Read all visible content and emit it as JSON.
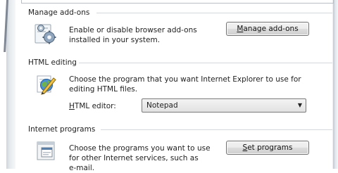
{
  "manage_addons": {
    "group_title": "Manage add-ons",
    "description_line1": "Enable or disable browser add-ons",
    "description_line2": "installed in your system.",
    "button_label_rest": "anage add-ons",
    "button_mnemonic": "M",
    "icon": "gears-icon"
  },
  "html_editing": {
    "group_title": "HTML editing",
    "description_line1": "Choose the program that you want Internet Explorer to use for",
    "description_line2": "editing HTML files.",
    "editor_label_mnemonic": "H",
    "editor_label_rest": "TML editor:",
    "editor_value": "Notepad",
    "icon": "pencil-page-icon"
  },
  "internet_programs": {
    "group_title": "Internet programs",
    "description_line1": "Choose the programs you want to use",
    "description_line2": "for other Internet services, such as",
    "description_line3": "e-mail.",
    "button_mnemonic": "S",
    "button_label_rest": "et programs",
    "icon": "programs-window-icon"
  }
}
